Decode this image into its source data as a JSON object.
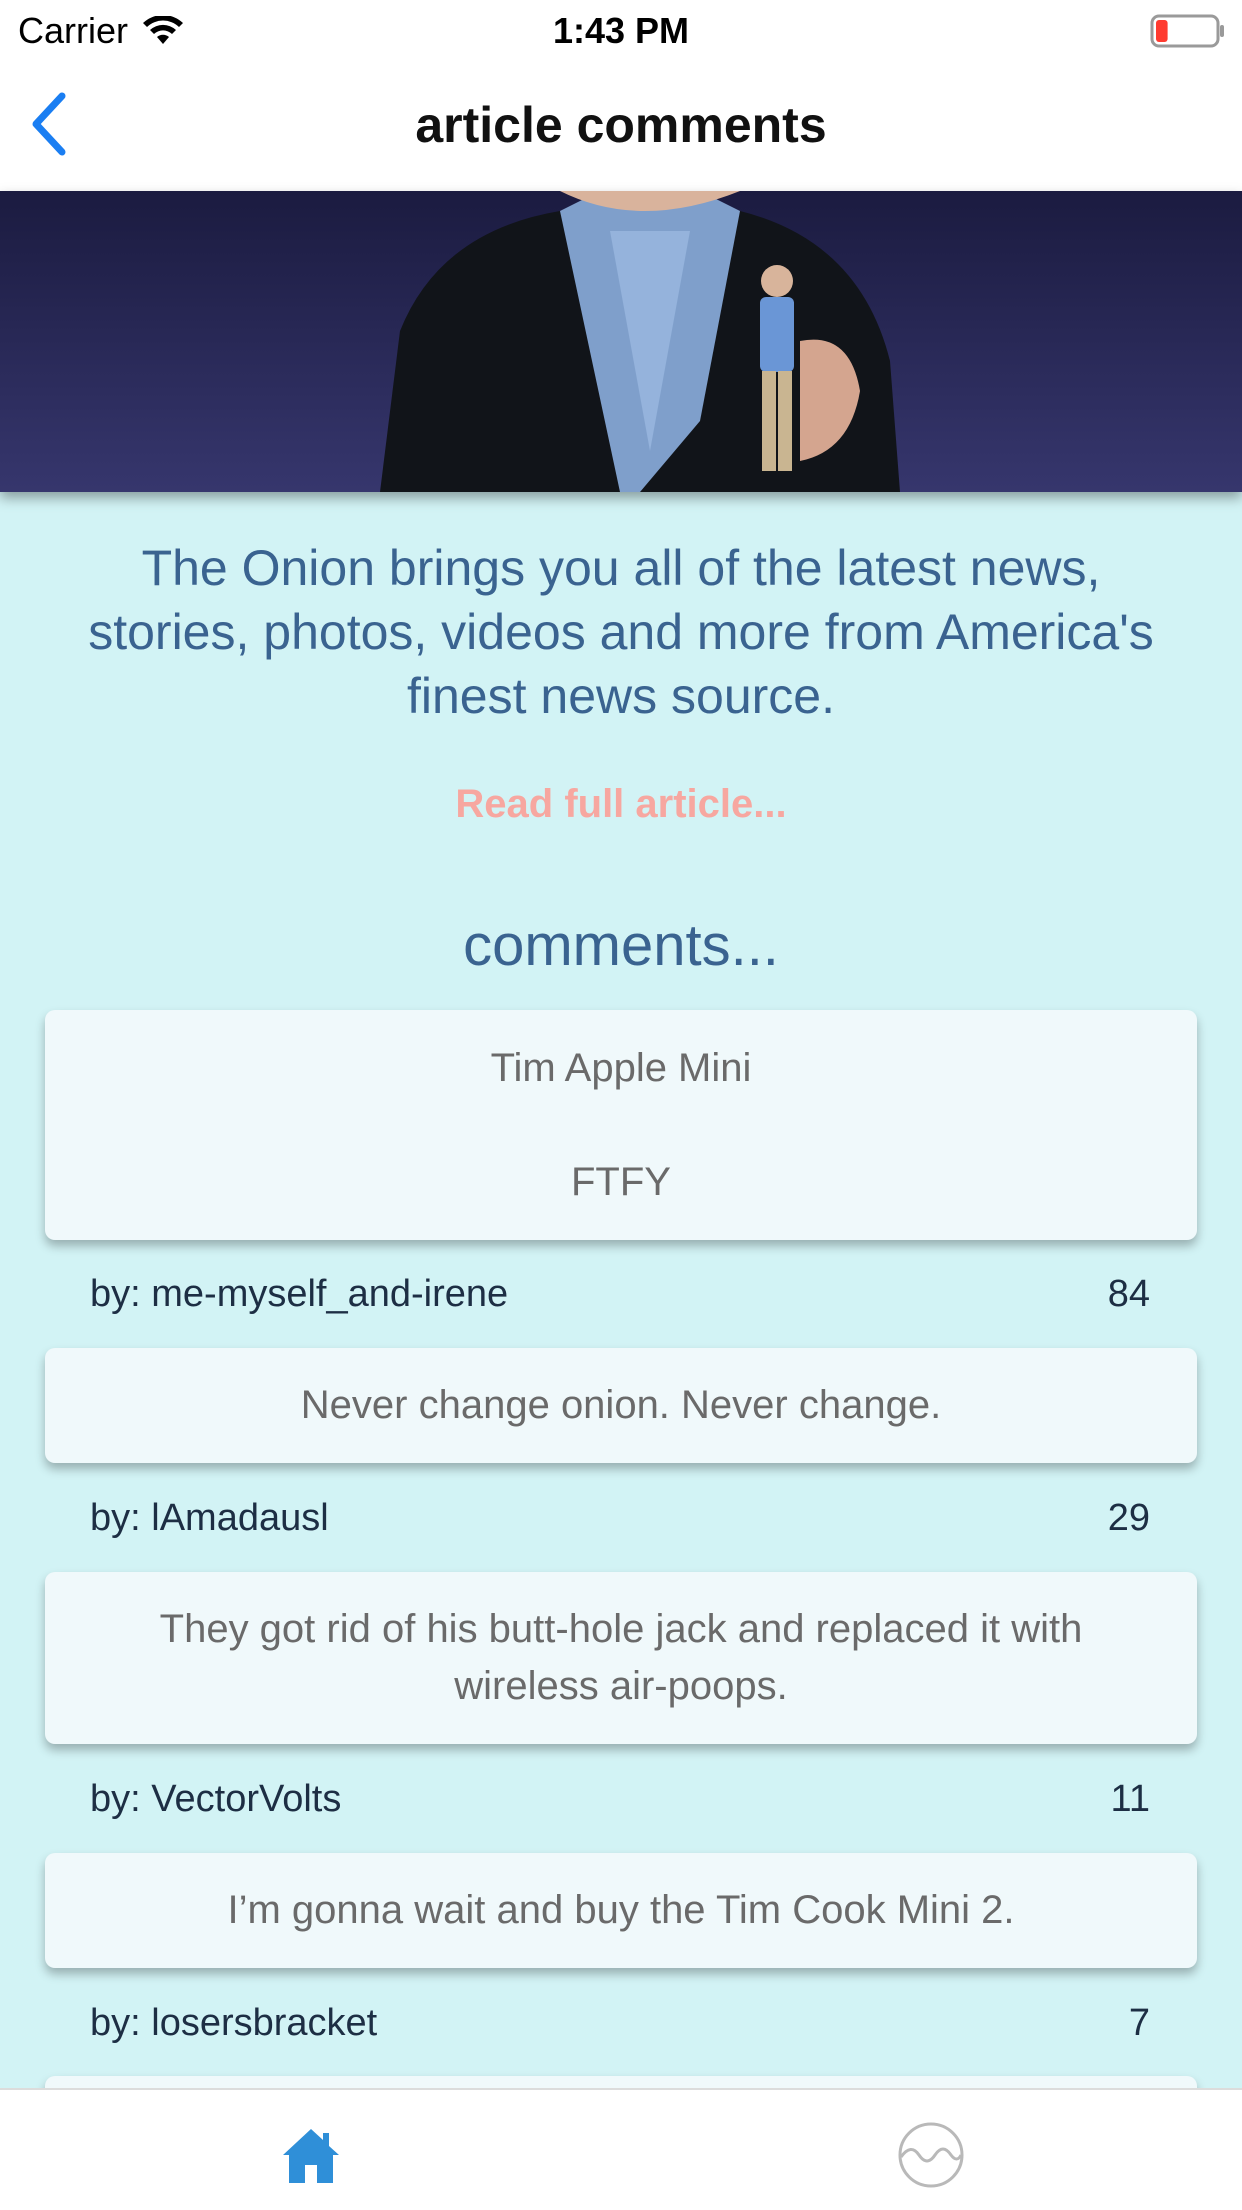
{
  "status_bar": {
    "carrier": "Carrier",
    "time": "1:43 PM",
    "battery_level": 0.1
  },
  "nav": {
    "title": "article comments",
    "back_icon": "chevron-left-icon"
  },
  "hero": {
    "icon": "article-photo"
  },
  "article": {
    "summary": "The Onion brings you all of the latest news, stories, photos, videos and more from America's finest news source.",
    "read_more": "Read full article..."
  },
  "comments_heading": "comments...",
  "comments": [
    {
      "lines": [
        "Tim Apple Mini",
        "FTFY"
      ],
      "author": "by: me-myself_and-irene",
      "score": "84"
    },
    {
      "lines": [
        "Never change onion. Never change."
      ],
      "author": "by: lAmadausl",
      "score": "29"
    },
    {
      "lines": [
        "They got rid of his butt-hole jack and replaced it with wireless air-poops."
      ],
      "author": "by: VectorVolts",
      "score": "11"
    },
    {
      "lines": [
        "I’m gonna wait and buy the Tim Cook Mini 2."
      ],
      "author": "by: losersbracket",
      "score": "7"
    }
  ],
  "tab_bar": {
    "tabs": [
      {
        "icon": "home-icon",
        "active": true
      },
      {
        "icon": "wave-circle-icon",
        "active": false
      }
    ]
  },
  "colors": {
    "background": "#d2f3f5",
    "accent": "#3a6390",
    "link": "#f7a7a0",
    "tab_active": "#2f8fd8",
    "tab_inactive": "#b9b9b9",
    "back_button": "#1a7ef2"
  }
}
